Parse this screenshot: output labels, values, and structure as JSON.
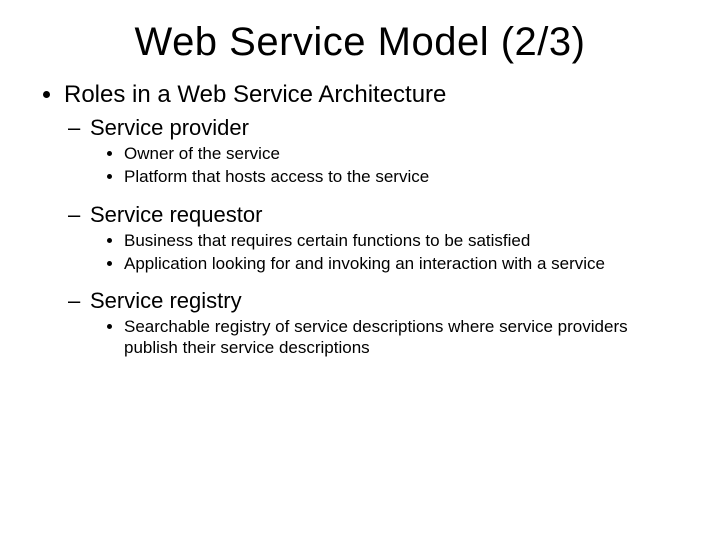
{
  "title": "Web Service Model (2/3)",
  "main": {
    "heading": "Roles in a Web Service Architecture",
    "roles": [
      {
        "name": "Service provider",
        "details": [
          "Owner of the service",
          "Platform that hosts access to the service"
        ]
      },
      {
        "name": "Service requestor",
        "details": [
          "Business that requires certain functions to be satisfied",
          "Application looking for and invoking an interaction with a service"
        ]
      },
      {
        "name": "Service registry",
        "details": [
          "Searchable registry of service descriptions where service providers publish their service descriptions"
        ]
      }
    ]
  }
}
